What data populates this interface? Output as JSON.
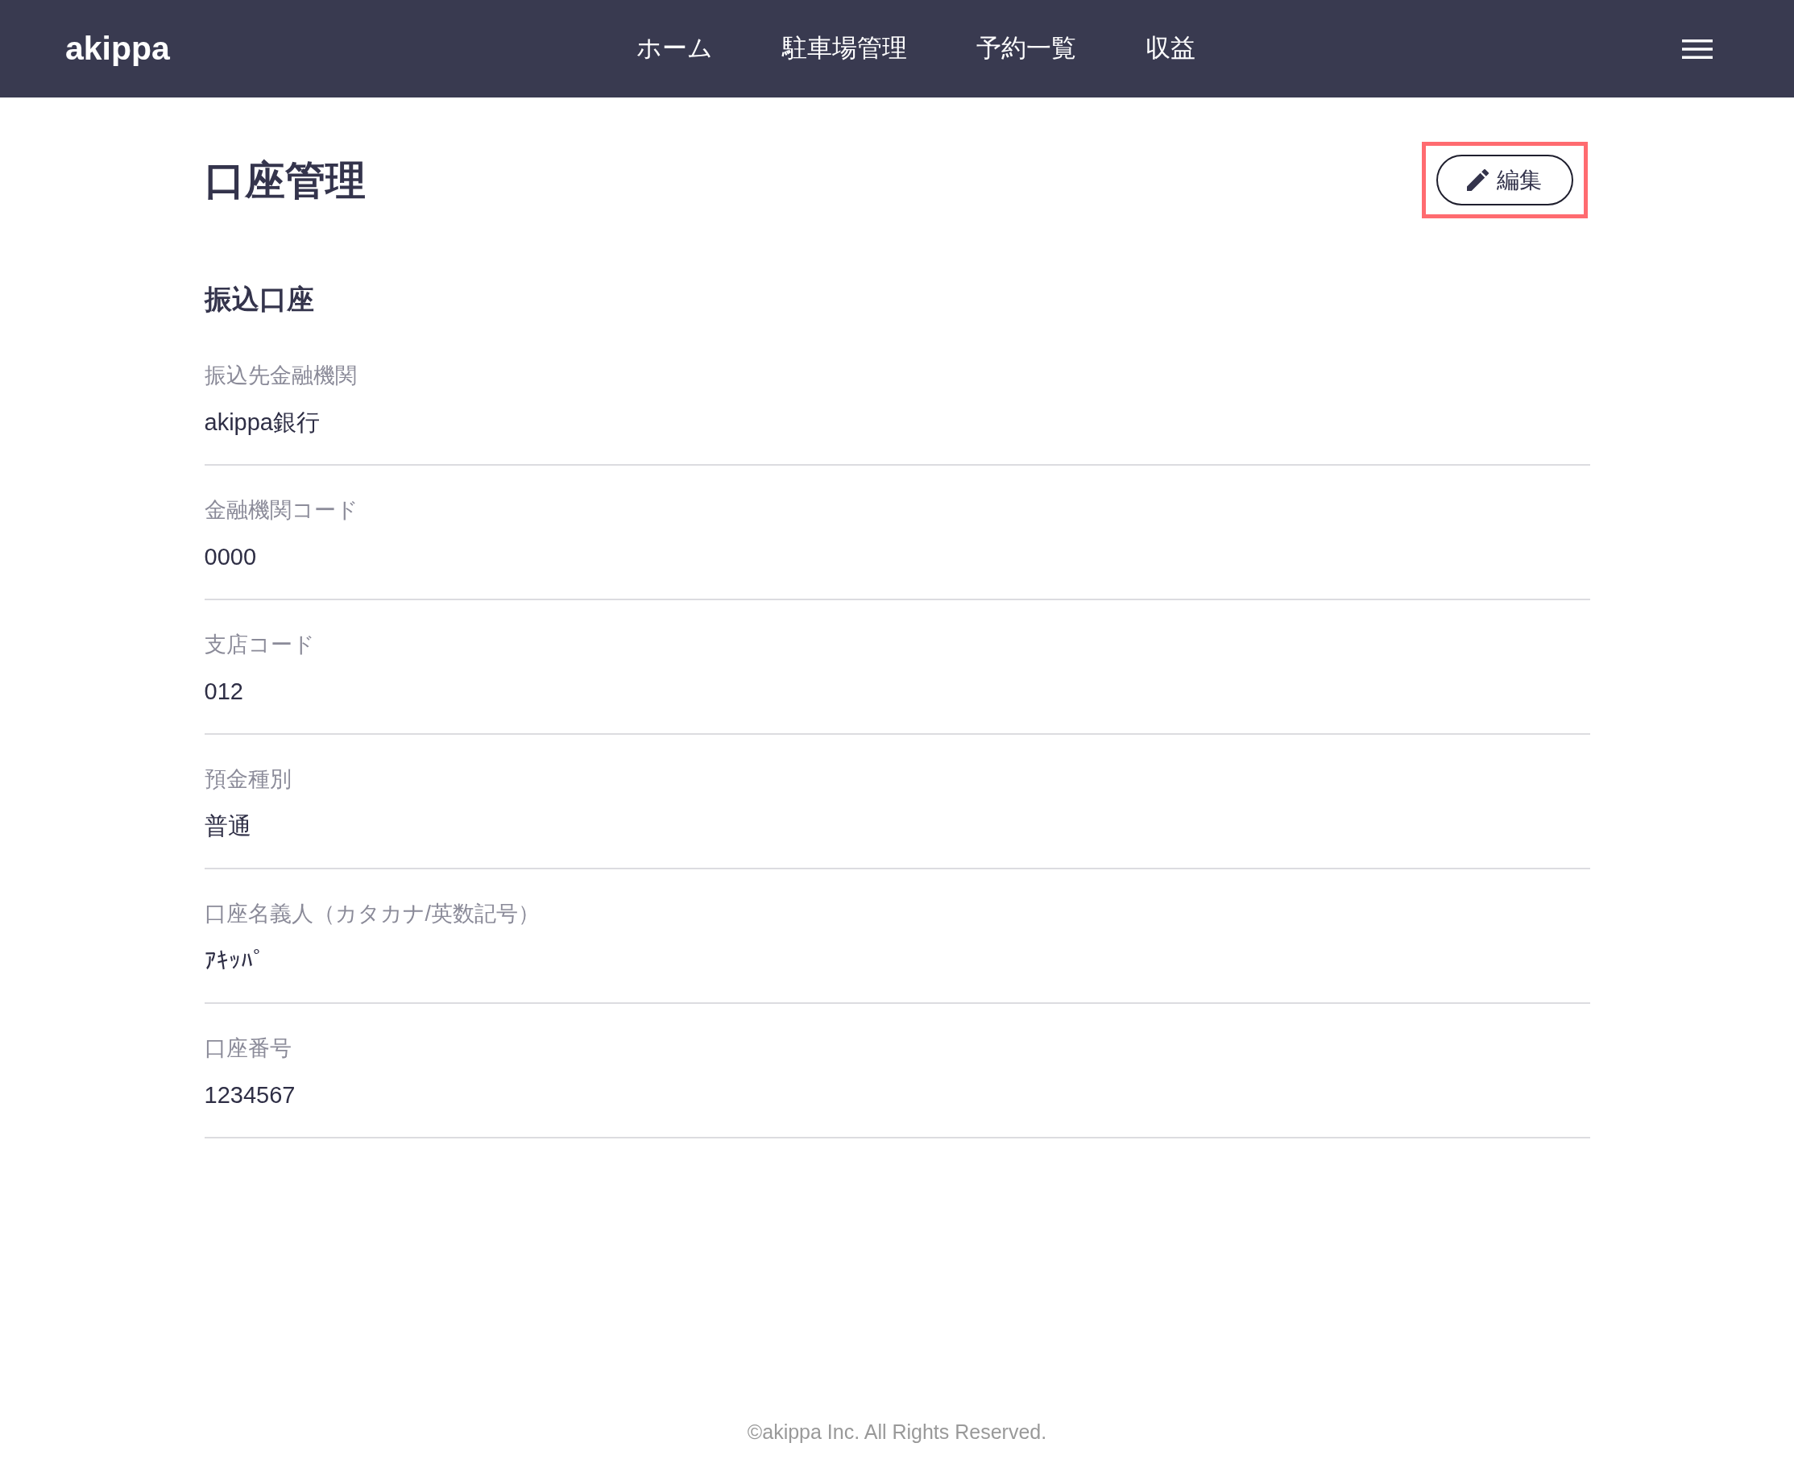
{
  "header": {
    "logo": "akippa",
    "nav": [
      "ホーム",
      "駐車場管理",
      "予約一覧",
      "収益"
    ]
  },
  "page": {
    "title": "口座管理",
    "edit_button": {
      "label": "編集",
      "highlighted": true
    }
  },
  "section": {
    "heading": "振込口座",
    "fields": [
      {
        "label": "振込先金融機関",
        "value": "akippa銀行"
      },
      {
        "label": "金融機関コード",
        "value": "0000"
      },
      {
        "label": "支店コード",
        "value": "012"
      },
      {
        "label": "預金種別",
        "value": "普通"
      },
      {
        "label": "口座名義人（カタカナ/英数記号）",
        "value": "ｱｷｯﾊﾟ"
      },
      {
        "label": "口座番号",
        "value": "1234567"
      }
    ]
  },
  "footer": {
    "text": "©akippa Inc. All Rights Reserved."
  }
}
